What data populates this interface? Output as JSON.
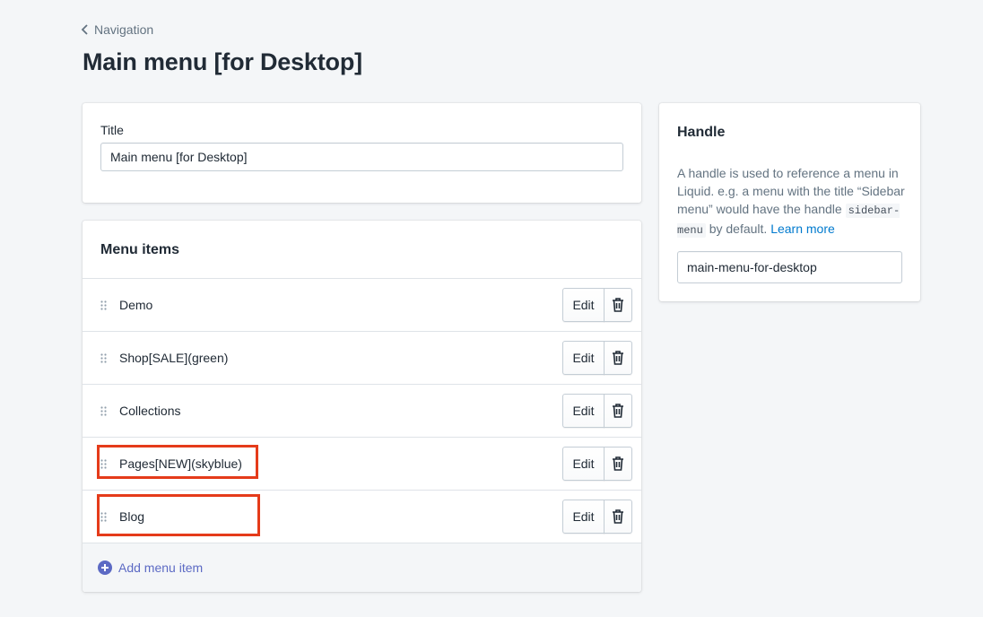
{
  "breadcrumb": {
    "label": "Navigation"
  },
  "page": {
    "title": "Main menu [for Desktop]"
  },
  "title_card": {
    "label": "Title",
    "value": "Main menu [for Desktop]"
  },
  "menu": {
    "heading": "Menu items",
    "edit_label": "Edit",
    "items": [
      {
        "label": "Demo"
      },
      {
        "label": "Shop[SALE](green)"
      },
      {
        "label": "Collections"
      },
      {
        "label": "Pages[NEW](skyblue)"
      },
      {
        "label": "Blog"
      }
    ],
    "add_label": "Add menu item"
  },
  "handle_card": {
    "heading": "Handle",
    "desc_part1": "A handle is used to reference a menu in Liquid. e.g. a menu with the title “Sidebar menu” would have the handle ",
    "code": "sidebar-menu",
    "desc_part2": " by default. ",
    "learn_more": "Learn more",
    "value": "main-menu-for-desktop"
  },
  "colors": {
    "accent": "#5c6ac4",
    "link": "#007ace",
    "highlight": "#e53b1a",
    "background": "#f4f6f8"
  },
  "icons": [
    "chevron-left-icon",
    "drag-handle-icon",
    "trash-icon",
    "plus-circle-icon"
  ]
}
